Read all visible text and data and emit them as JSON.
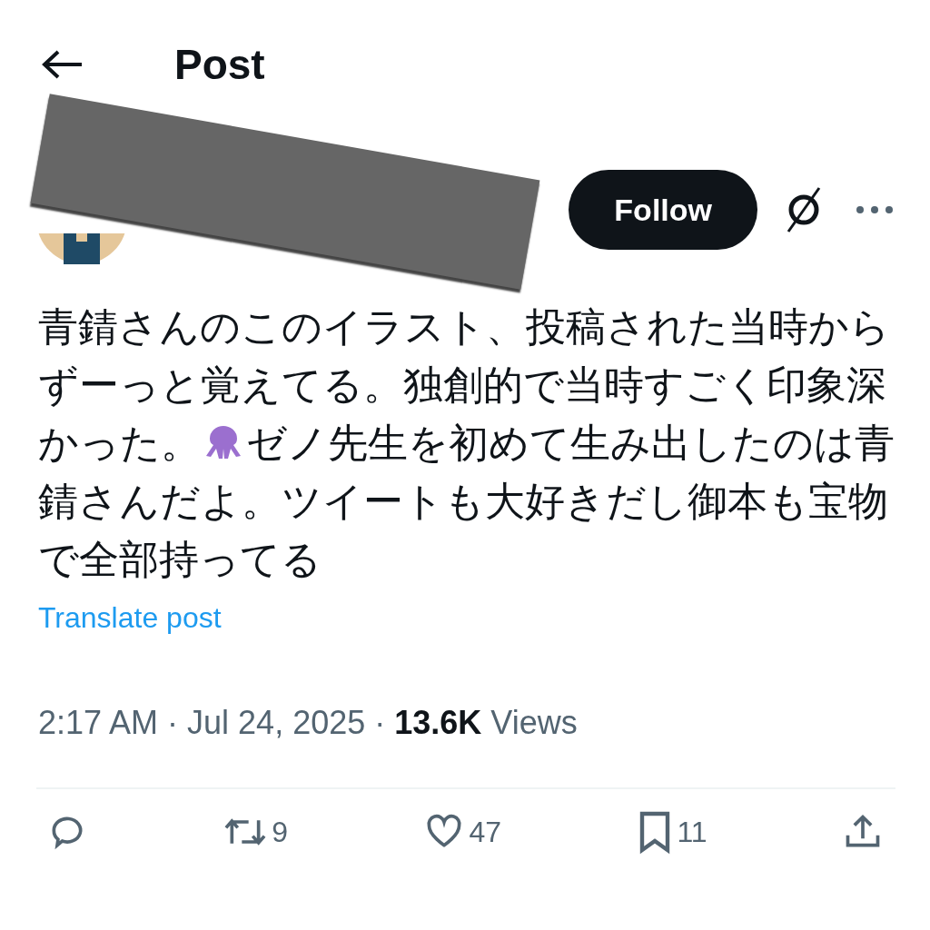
{
  "header": {
    "title": "Post"
  },
  "author": {
    "follow_label": "Follow"
  },
  "post": {
    "body": [
      [
        {
          "kind": "text",
          "text": "青錆さんのこのイラスト、投稿された当時から"
        }
      ],
      [
        {
          "kind": "text",
          "text": "ずーっと覚えてる。独創的で当時すごく印象深"
        }
      ],
      [
        {
          "kind": "text",
          "text": "かった。"
        },
        {
          "kind": "emoji"
        },
        {
          "kind": "text",
          "text": "ゼノ先生を初めて生み出したのは青"
        }
      ],
      [
        {
          "kind": "text",
          "text": "錆さんだよ。ツイートも大好きだし御本も宝物"
        }
      ],
      [
        {
          "kind": "text",
          "text": "で全部持ってる"
        }
      ]
    ],
    "translate": "Translate post",
    "time": "2:17 AM · Jul 24, 2025 · ",
    "views_count": "13.6K",
    "views_label": " Views"
  },
  "actions": [
    {
      "kind": "reply"
    },
    {
      "kind": "repost",
      "count": "9"
    },
    {
      "kind": "like",
      "count": "47"
    },
    {
      "kind": "bookmark",
      "count": "11"
    },
    {
      "kind": "share"
    }
  ]
}
